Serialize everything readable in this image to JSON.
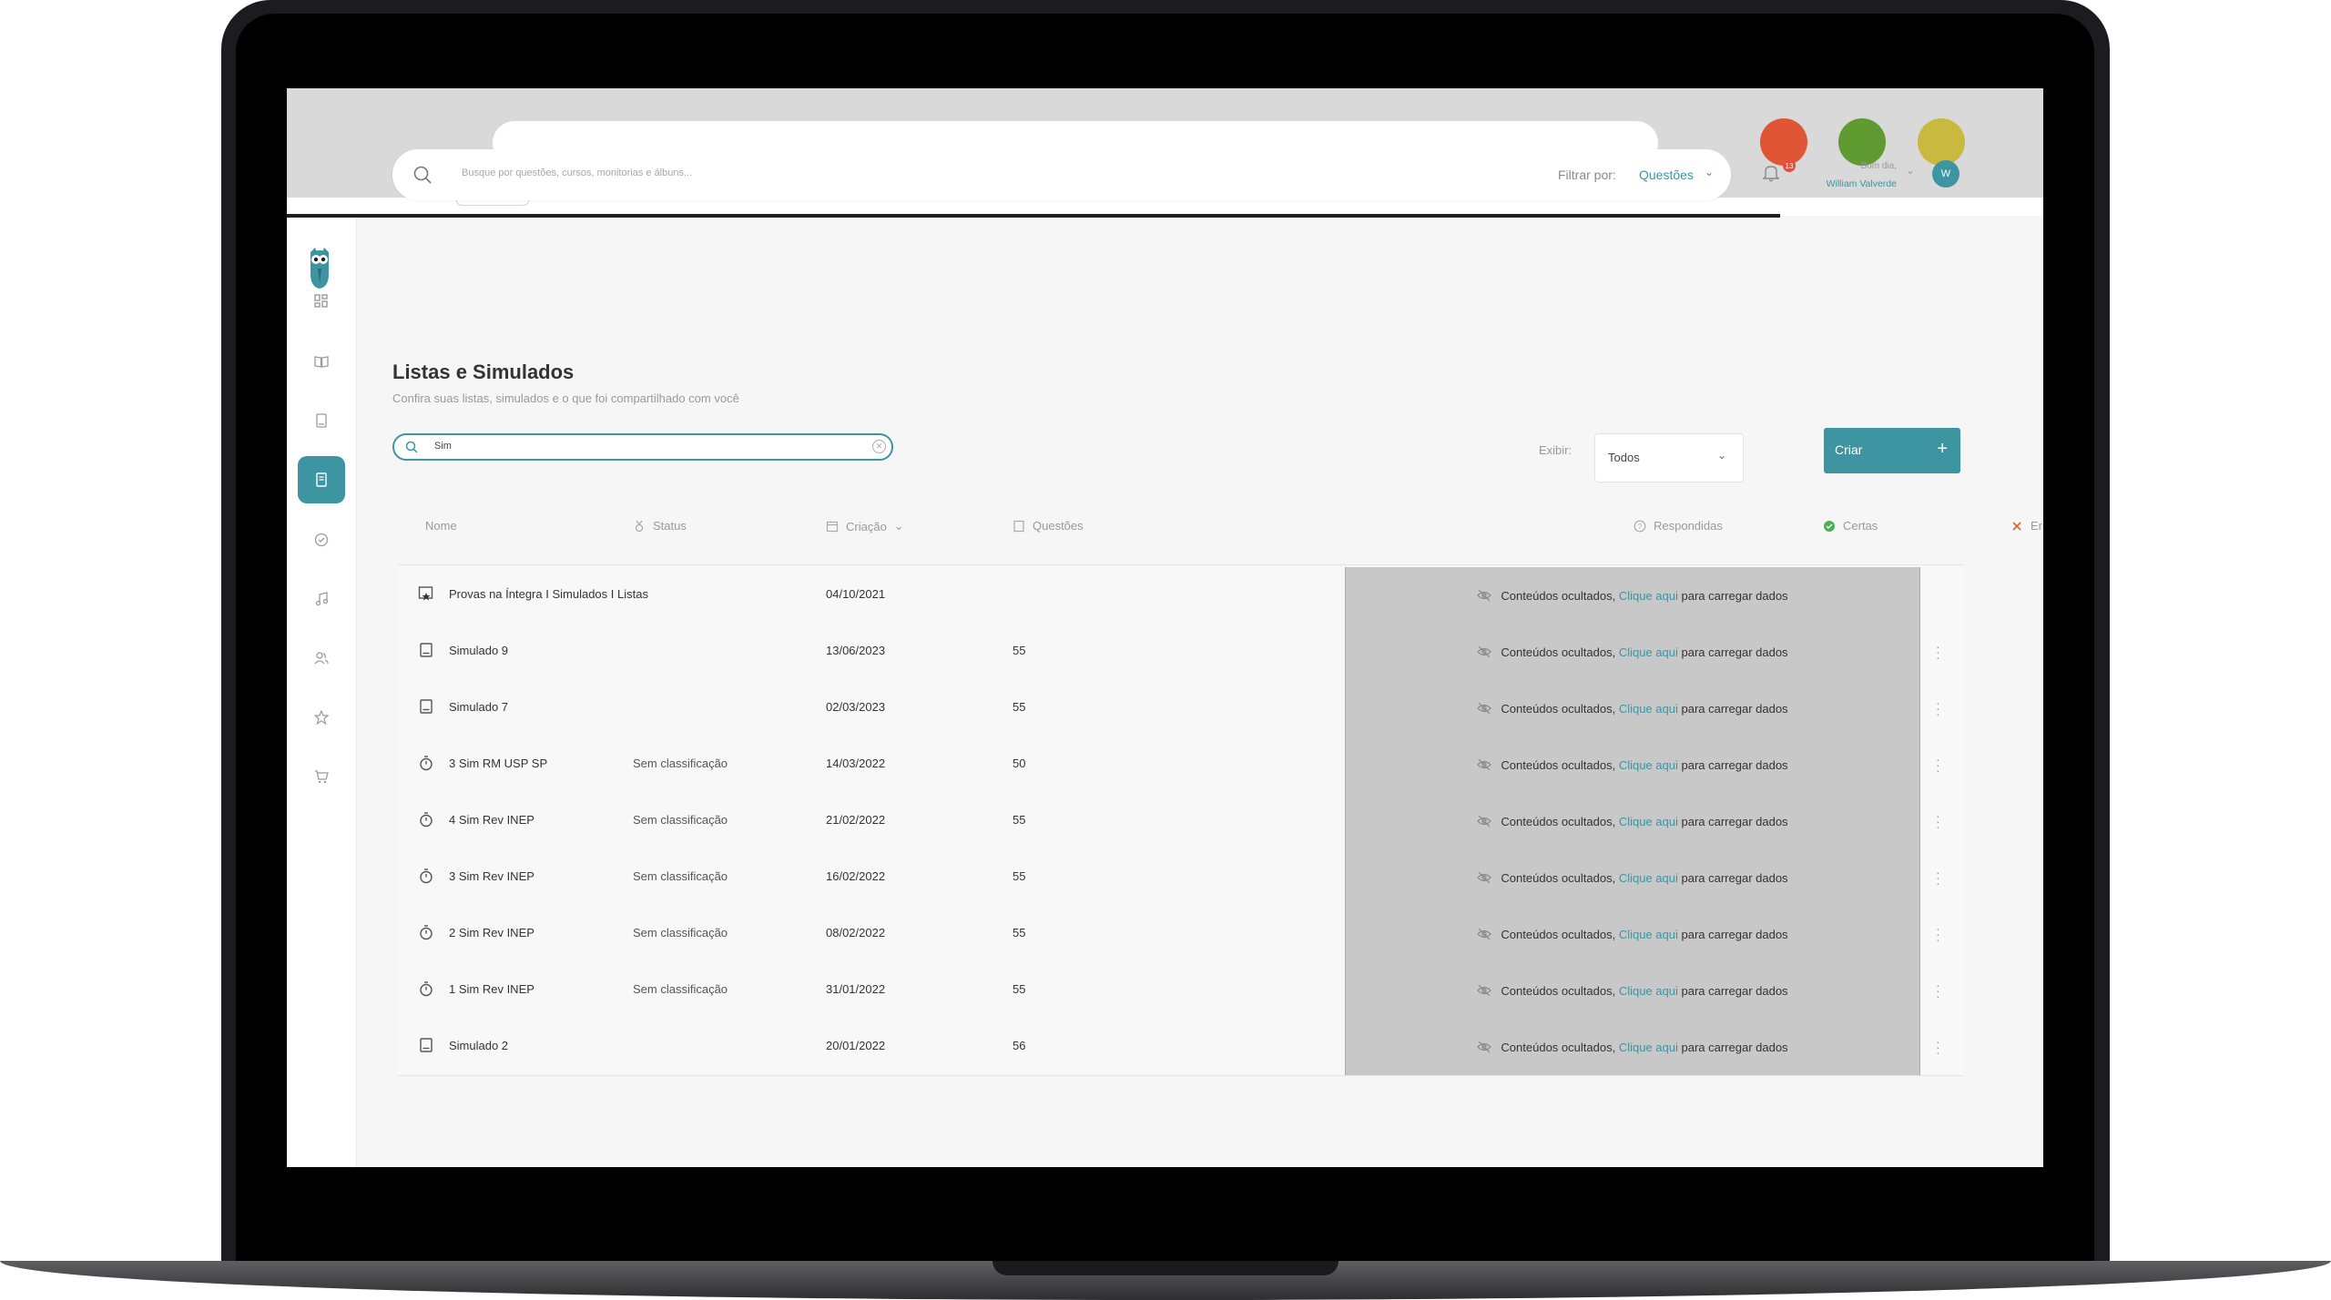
{
  "colors": {
    "accent": "#3d95a2",
    "traffic_red": "#e05533",
    "traffic_green": "#5f9b30",
    "traffic_yellow": "#c9b93e",
    "badge": "#e74c3c"
  },
  "header": {
    "search_placeholder": "Busque por questões, cursos, monitorias e álbuns...",
    "filter_label": "Filtrar por:",
    "filter_value": "Questões",
    "notification_count": "13",
    "greeting": "Bom dia,",
    "user_name": "William Valverde",
    "avatar_initial": "W"
  },
  "sidebar": {
    "items": [
      {
        "icon": "dashboard-icon"
      },
      {
        "icon": "book-open-icon"
      },
      {
        "icon": "book-icon"
      },
      {
        "icon": "list-icon",
        "active": true
      },
      {
        "icon": "check-circle-icon"
      },
      {
        "icon": "music-note-icon"
      },
      {
        "icon": "users-icon"
      },
      {
        "icon": "star-icon"
      },
      {
        "icon": "cart-icon"
      }
    ]
  },
  "page": {
    "title": "Listas e Simulados",
    "subtitle": "Confira suas listas, simulados e o que foi compartilhado com você",
    "search_value": "Sim",
    "exibir_label": "Exibir:",
    "exibir_value": "Todos",
    "create_label": "Criar",
    "create_plus": "+"
  },
  "table": {
    "columns": {
      "nome": "Nome",
      "status": "Status",
      "criacao": "Criação",
      "questoes": "Questões",
      "respondidas": "Respondidas",
      "certas": "Certas",
      "erradas": "Erradas"
    },
    "hidden_text_a": "Conteúdos ocultados,",
    "hidden_link": "Clique aqui",
    "hidden_text_b": "para carregar dados",
    "rows": [
      {
        "icon": "folder-star-icon",
        "name": "Provas na Íntegra I Simulados I Listas",
        "status": "",
        "date": "04/10/2021",
        "questions": "",
        "menu": false
      },
      {
        "icon": "list-doc-icon",
        "name": "Simulado 9",
        "status": "",
        "date": "13/06/2023",
        "questions": "55",
        "menu": true
      },
      {
        "icon": "list-doc-icon",
        "name": "Simulado 7",
        "status": "",
        "date": "02/03/2023",
        "questions": "55",
        "menu": true
      },
      {
        "icon": "stopwatch-icon",
        "name": "3 Sim RM USP SP",
        "status": "Sem classificação",
        "date": "14/03/2022",
        "questions": "50",
        "menu": true
      },
      {
        "icon": "stopwatch-icon",
        "name": "4 Sim Rev INEP",
        "status": "Sem classificação",
        "date": "21/02/2022",
        "questions": "55",
        "menu": true
      },
      {
        "icon": "stopwatch-icon",
        "name": "3 Sim Rev INEP",
        "status": "Sem classificação",
        "date": "16/02/2022",
        "questions": "55",
        "menu": true
      },
      {
        "icon": "stopwatch-icon",
        "name": "2 Sim Rev INEP",
        "status": "Sem classificação",
        "date": "08/02/2022",
        "questions": "55",
        "menu": true
      },
      {
        "icon": "stopwatch-icon",
        "name": "1 Sim Rev INEP",
        "status": "Sem classificação",
        "date": "31/01/2022",
        "questions": "55",
        "menu": true
      },
      {
        "icon": "list-doc-icon",
        "name": "Simulado 2",
        "status": "",
        "date": "20/01/2022",
        "questions": "56",
        "menu": true
      }
    ]
  }
}
